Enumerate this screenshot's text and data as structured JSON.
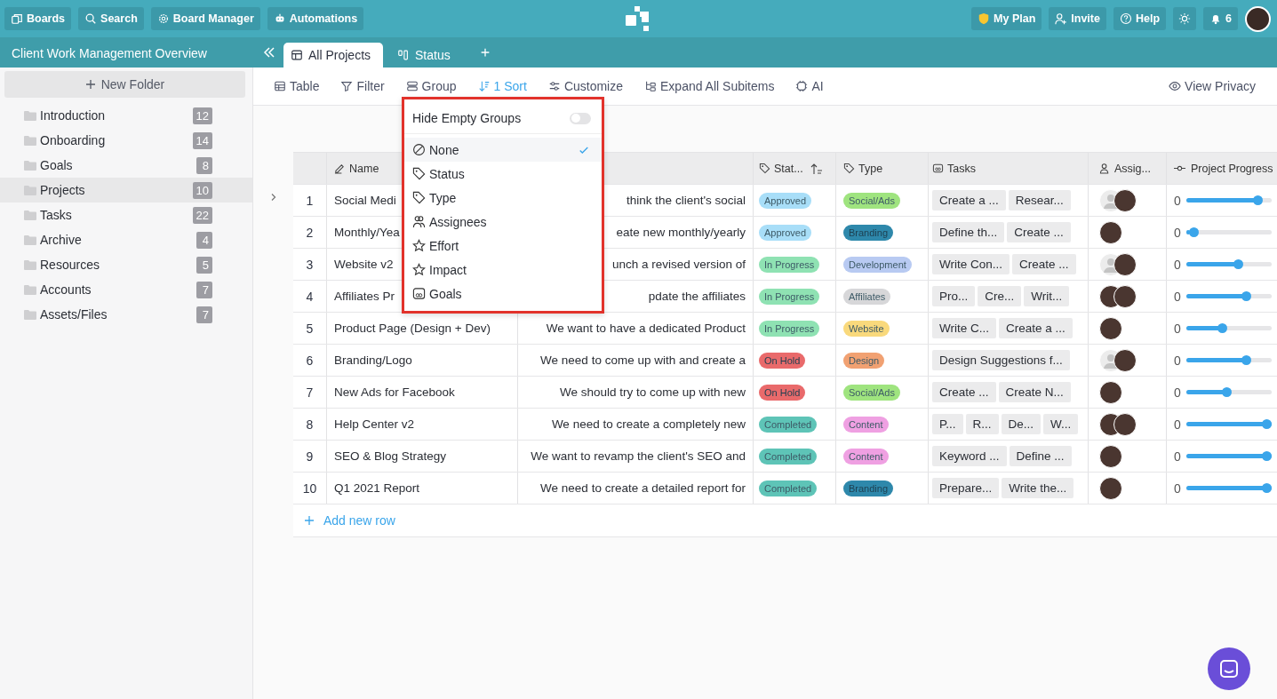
{
  "topbar": {
    "left_buttons": [
      {
        "label": "Boards",
        "kind": "boards"
      },
      {
        "label": "Search",
        "kind": "search"
      },
      {
        "label": "Board Manager",
        "kind": "settings"
      },
      {
        "label": "Automations",
        "kind": "robot"
      }
    ],
    "right_buttons": [
      {
        "label": "My Plan",
        "kind": "plan"
      },
      {
        "label": "Invite",
        "kind": "invite"
      },
      {
        "label": "Help",
        "kind": "help"
      }
    ],
    "notifications": "6"
  },
  "sidebar": {
    "title": "Client Work Management Overview",
    "new_folder": "New Folder",
    "items": [
      {
        "label": "Introduction",
        "count": "12",
        "selected": false
      },
      {
        "label": "Onboarding",
        "count": "14",
        "selected": false
      },
      {
        "label": "Goals",
        "count": "8",
        "selected": false
      },
      {
        "label": "Projects",
        "count": "10",
        "selected": true
      },
      {
        "label": "Tasks",
        "count": "22",
        "selected": false
      },
      {
        "label": "Archive",
        "count": "4",
        "selected": false
      },
      {
        "label": "Resources",
        "count": "5",
        "selected": false
      },
      {
        "label": "Accounts",
        "count": "7",
        "selected": false
      },
      {
        "label": "Assets/Files",
        "count": "7",
        "selected": false
      }
    ]
  },
  "tabs": [
    {
      "label": "All Projects",
      "kind": "table",
      "selected": true
    },
    {
      "label": "Status",
      "kind": "kanban",
      "selected": false
    }
  ],
  "toolbar": {
    "items": [
      {
        "label": "Table",
        "kind": "table",
        "active": false
      },
      {
        "label": "Filter",
        "kind": "filter",
        "active": false
      },
      {
        "label": "Group",
        "kind": "group",
        "active": false
      },
      {
        "label": "1 Sort",
        "kind": "sort",
        "active": true
      },
      {
        "label": "Customize",
        "kind": "customize",
        "active": false
      },
      {
        "label": "Expand All Subitems",
        "kind": "expand",
        "active": false
      },
      {
        "label": "AI",
        "kind": "ai",
        "active": false
      }
    ],
    "privacy": "View Privacy"
  },
  "group_menu": {
    "toggle_label": "Hide Empty Groups",
    "toggle_on": false,
    "options": [
      {
        "label": "None",
        "kind": "none",
        "selected": true
      },
      {
        "label": "Status",
        "kind": "label",
        "selected": false
      },
      {
        "label": "Type",
        "kind": "label",
        "selected": false
      },
      {
        "label": "Assignees",
        "kind": "person",
        "selected": false
      },
      {
        "label": "Effort",
        "kind": "rating",
        "selected": false
      },
      {
        "label": "Impact",
        "kind": "rating",
        "selected": false
      },
      {
        "label": "Goals",
        "kind": "relation",
        "selected": false
      }
    ]
  },
  "table": {
    "columns": [
      {
        "label": "Name",
        "kind": "name"
      },
      {
        "kind": "description"
      },
      {
        "label": "Stat...",
        "kind": "status",
        "sorted": true
      },
      {
        "label": "Type",
        "kind": "type"
      },
      {
        "label": "Tasks",
        "kind": "tasks"
      },
      {
        "label": "Assig...",
        "kind": "assignees"
      },
      {
        "label": "Project Progress",
        "kind": "progress"
      }
    ],
    "rows": [
      {
        "number": "1",
        "name": "Social Medi",
        "description": "think the client's social",
        "status": {
          "label": "Approved",
          "color": "#a8def8"
        },
        "type": {
          "label": "Social/Ads",
          "color": "#9fe47f"
        },
        "tasks": [
          "Create a ...",
          "Resear..."
        ],
        "assignees": [
          {
            "kind": "placeholder"
          },
          {
            "kind": "photo"
          }
        ],
        "progress": "0",
        "level": 0.89
      },
      {
        "number": "2",
        "name": "Monthly/Yea",
        "description": "eate new monthly/yearly",
        "status": {
          "label": "Approved",
          "color": "#a8def8"
        },
        "type": {
          "label": "Branding",
          "color": "#2e88ab"
        },
        "tasks": [
          "Define th...",
          "Create ..."
        ],
        "assignees": [
          {
            "kind": "photo"
          }
        ],
        "progress": "0",
        "level": 0.04
      },
      {
        "number": "3",
        "name": "Website v2",
        "description": "unch a revised version of",
        "status": {
          "label": "In Progress",
          "color": "#8fe2b3"
        },
        "type": {
          "label": "Development",
          "color": "#b8caf2"
        },
        "tasks": [
          "Write Con...",
          "Create ..."
        ],
        "assignees": [
          {
            "kind": "placeholder"
          },
          {
            "kind": "photo"
          }
        ],
        "progress": "0",
        "level": 0.63
      },
      {
        "number": "4",
        "name": "Affiliates Pr",
        "description": "pdate the affiliates",
        "status": {
          "label": "In Progress",
          "color": "#8fe2b3"
        },
        "type": {
          "label": "Affiliates",
          "color": "#d7d7d9"
        },
        "tasks": [
          "Pro...",
          "Cre...",
          "Writ..."
        ],
        "assignees": [
          {
            "kind": "photo"
          },
          {
            "kind": "photo"
          }
        ],
        "progress": "0",
        "level": 0.73
      },
      {
        "number": "5",
        "name": "Product Page (Design + Dev)",
        "description": "We want to have a dedicated Product",
        "status": {
          "label": "In Progress",
          "color": "#8fe2b3"
        },
        "type": {
          "label": "Website",
          "color": "#f9d97c"
        },
        "tasks": [
          "Write C...",
          "Create a ..."
        ],
        "assignees": [
          {
            "kind": "photo"
          }
        ],
        "progress": "0",
        "level": 0.42
      },
      {
        "number": "6",
        "name": "Branding/Logo",
        "description": "We need to come up with and create a",
        "status": {
          "label": "On Hold",
          "color": "#e96a6b"
        },
        "type": {
          "label": "Design",
          "color": "#f1a172"
        },
        "tasks": [
          "Design Suggestions f..."
        ],
        "assignees": [
          {
            "kind": "placeholder"
          },
          {
            "kind": "photo"
          }
        ],
        "progress": "0",
        "level": 0.73
      },
      {
        "number": "7",
        "name": "New Ads for Facebook",
        "description": "We should try to come up with new",
        "status": {
          "label": "On Hold",
          "color": "#e96a6b"
        },
        "type": {
          "label": "Social/Ads",
          "color": "#9fe47f"
        },
        "tasks": [
          "Create ...",
          "Create N..."
        ],
        "assignees": [
          {
            "kind": "photo"
          }
        ],
        "progress": "0",
        "level": 0.47
      },
      {
        "number": "8",
        "name": "Help Center v2",
        "description": "We need to create a completely new",
        "status": {
          "label": "Completed",
          "color": "#5ec4b7"
        },
        "type": {
          "label": "Content",
          "color": "#efa0e2"
        },
        "tasks": [
          "P...",
          "R...",
          "De...",
          "W..."
        ],
        "assignees": [
          {
            "kind": "photo"
          },
          {
            "kind": "photo"
          }
        ],
        "progress": "0",
        "level": 1
      },
      {
        "number": "9",
        "name": "SEO & Blog Strategy",
        "description": "We want to revamp the client's SEO and",
        "status": {
          "label": "Completed",
          "color": "#5ec4b7"
        },
        "type": {
          "label": "Content",
          "color": "#efa0e2"
        },
        "tasks": [
          "Keyword ...",
          "Define ..."
        ],
        "assignees": [
          {
            "kind": "photo"
          }
        ],
        "progress": "0",
        "level": 1
      },
      {
        "number": "10",
        "name": "Q1 2021 Report",
        "description": "We need to create a detailed report for",
        "status": {
          "label": "Completed",
          "color": "#5ec4b7"
        },
        "type": {
          "label": "Branding",
          "color": "#2e88ab"
        },
        "tasks": [
          "Prepare...",
          "Write the..."
        ],
        "assignees": [
          {
            "kind": "photo"
          }
        ],
        "progress": "0",
        "level": 1
      }
    ],
    "add_row": "Add new row"
  }
}
